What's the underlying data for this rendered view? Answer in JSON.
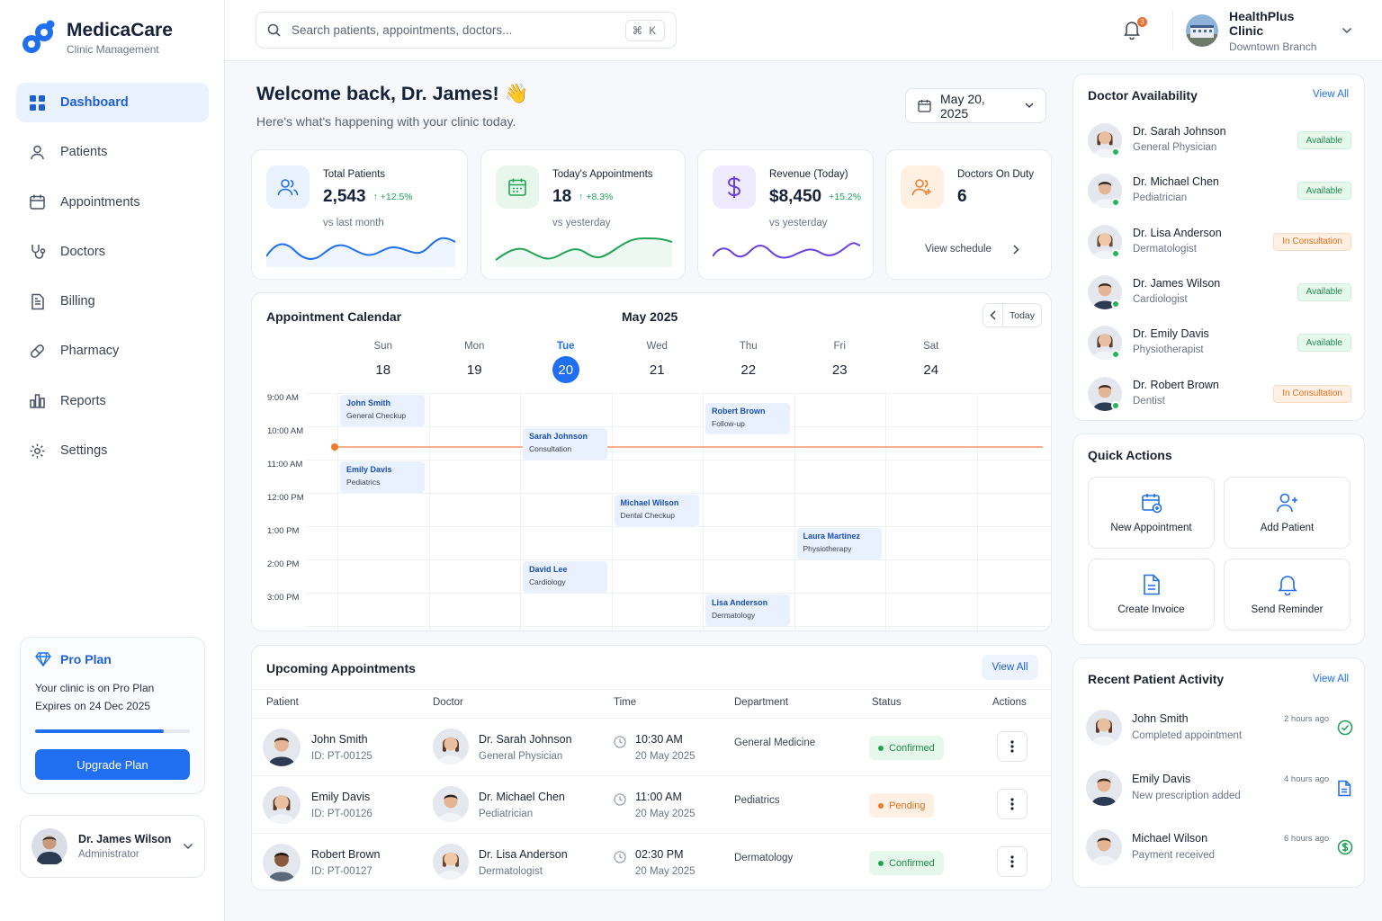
{
  "app": {
    "name": "MedicaCare",
    "subtitle": "Clinic Management"
  },
  "sidebar": {
    "items": [
      {
        "label": "Dashboard",
        "icon": "grid-icon",
        "active": true
      },
      {
        "label": "Patients",
        "icon": "user-icon"
      },
      {
        "label": "Appointments",
        "icon": "calendar-icon"
      },
      {
        "label": "Doctors",
        "icon": "stethoscope-icon"
      },
      {
        "label": "Billing",
        "icon": "invoice-icon"
      },
      {
        "label": "Pharmacy",
        "icon": "pill-icon"
      },
      {
        "label": "Reports",
        "icon": "bar-chart-icon"
      },
      {
        "label": "Settings",
        "icon": "gear-icon"
      }
    ],
    "pro": {
      "title": "Pro Plan",
      "line1": "Your clinic is on Pro Plan",
      "line2": "Expires on 24 Dec 2025",
      "progress": 0.83,
      "button": "Upgrade Plan"
    },
    "user": {
      "name": "Dr. James Wilson",
      "role": "Administrator"
    }
  },
  "topbar": {
    "search_placeholder": "Search patients, appointments, doctors...",
    "shortcut": "⌘ K",
    "notifications": "3",
    "clinic_name": "HealthPlus Clinic",
    "clinic_branch": "Downtown Branch"
  },
  "welcome": {
    "title": "Welcome back, Dr. James!",
    "emoji": "👋",
    "subtitle": "Here's what's happening with your clinic today.",
    "date": "May 20, 2025"
  },
  "stats": [
    {
      "label": "Total Patients",
      "value": "2,543",
      "delta": "+12.5%",
      "sub": "vs last month",
      "color": "#1f6ff0"
    },
    {
      "label": "Today's Appointments",
      "value": "18",
      "delta": "+8.3%",
      "sub": "vs yesterday",
      "color": "#22a456"
    },
    {
      "label": "Revenue (Today)",
      "value": "$8,450",
      "delta": "+15.2%",
      "sub": "vs yesterday",
      "color": "#6a3fe0"
    },
    {
      "label": "Doctors On Duty",
      "value": "6",
      "link": "View schedule",
      "color": "#f07a2a"
    }
  ],
  "calendar": {
    "title": "Appointment Calendar",
    "month": "May 2025",
    "today_label": "Today",
    "days": [
      {
        "name": "Sun",
        "num": "18"
      },
      {
        "name": "Mon",
        "num": "19"
      },
      {
        "name": "Tue",
        "num": "20",
        "current": true
      },
      {
        "name": "Wed",
        "num": "21"
      },
      {
        "name": "Thu",
        "num": "22"
      },
      {
        "name": "Fri",
        "num": "23"
      },
      {
        "name": "Sat",
        "num": "24"
      }
    ],
    "times": [
      "9:00 AM",
      "10:00 AM",
      "11:00 AM",
      "12:00 PM",
      "1:00 PM",
      "2:00 PM",
      "3:00 PM"
    ],
    "events": [
      {
        "name": "John Smith",
        "type": "General Checkup",
        "day": 0,
        "start": 0.05
      },
      {
        "name": "Sarah Johnson",
        "type": "Consultation",
        "day": 2,
        "start": 1.05
      },
      {
        "name": "Robert Brown",
        "type": "Follow-up",
        "day": 4,
        "start": 0.3
      },
      {
        "name": "Emily Davis",
        "type": "Pediatrics",
        "day": 0,
        "start": 2.05
      },
      {
        "name": "Michael Wilson",
        "type": "Dental Checkup",
        "day": 3,
        "start": 3.05
      },
      {
        "name": "Laura Martinez",
        "type": "Physiotherapy",
        "day": 5,
        "start": 4.05
      },
      {
        "name": "David Lee",
        "type": "Cardiology",
        "day": 2,
        "start": 5.05
      },
      {
        "name": "Lisa Anderson",
        "type": "Dermatology",
        "day": 4,
        "start": 6.05
      }
    ]
  },
  "upcoming": {
    "title": "Upcoming Appointments",
    "view_all": "View All",
    "headers": [
      "Patient",
      "Doctor",
      "Time",
      "Department",
      "Status",
      "Actions"
    ],
    "rows": [
      {
        "patient": "John Smith",
        "pid": "ID: PT-00125",
        "doctor": "Dr. Sarah Johnson",
        "dspec": "General Physician",
        "time": "10:30 AM",
        "date": "20 May 2025",
        "dept": "General Medicine",
        "status": "Confirmed"
      },
      {
        "patient": "Emily Davis",
        "pid": "ID: PT-00126",
        "doctor": "Dr. Michael Chen",
        "dspec": "Pediatrician",
        "time": "11:00 AM",
        "date": "20 May 2025",
        "dept": "Pediatrics",
        "status": "Pending"
      },
      {
        "patient": "Robert Brown",
        "pid": "ID: PT-00127",
        "doctor": "Dr. Lisa Anderson",
        "dspec": "Dermatologist",
        "time": "02:30 PM",
        "date": "20 May 2025",
        "dept": "Dermatology",
        "status": "Confirmed"
      }
    ]
  },
  "availability": {
    "title": "Doctor Availability",
    "view_all": "View All",
    "doctors": [
      {
        "name": "Dr. Sarah Johnson",
        "spec": "General Physician",
        "status": "Available"
      },
      {
        "name": "Dr. Michael Chen",
        "spec": "Pediatrician",
        "status": "Available"
      },
      {
        "name": "Dr. Lisa Anderson",
        "spec": "Dermatologist",
        "status": "In Consultation"
      },
      {
        "name": "Dr. James Wilson",
        "spec": "Cardiologist",
        "status": "Available"
      },
      {
        "name": "Dr. Emily Davis",
        "spec": "Physiotherapist",
        "status": "Available"
      },
      {
        "name": "Dr. Robert Brown",
        "spec": "Dentist",
        "status": "In Consultation"
      }
    ]
  },
  "quick_actions": {
    "title": "Quick Actions",
    "items": [
      {
        "label": "New Appointment",
        "icon": "calendar-plus-icon"
      },
      {
        "label": "Add Patient",
        "icon": "user-plus-icon"
      },
      {
        "label": "Create Invoice",
        "icon": "invoice-icon"
      },
      {
        "label": "Send Reminder",
        "icon": "bell-icon"
      }
    ]
  },
  "activity": {
    "title": "Recent Patient Activity",
    "view_all": "View All",
    "items": [
      {
        "name": "John Smith",
        "desc": "Completed appointment",
        "time": "2 hours ago",
        "icon": "check-circle-icon"
      },
      {
        "name": "Emily Davis",
        "desc": "New prescription added",
        "time": "4 hours ago",
        "icon": "document-icon"
      },
      {
        "name": "Michael Wilson",
        "desc": "Payment received",
        "time": "6 hours ago",
        "icon": "dollar-circle-icon"
      }
    ]
  }
}
